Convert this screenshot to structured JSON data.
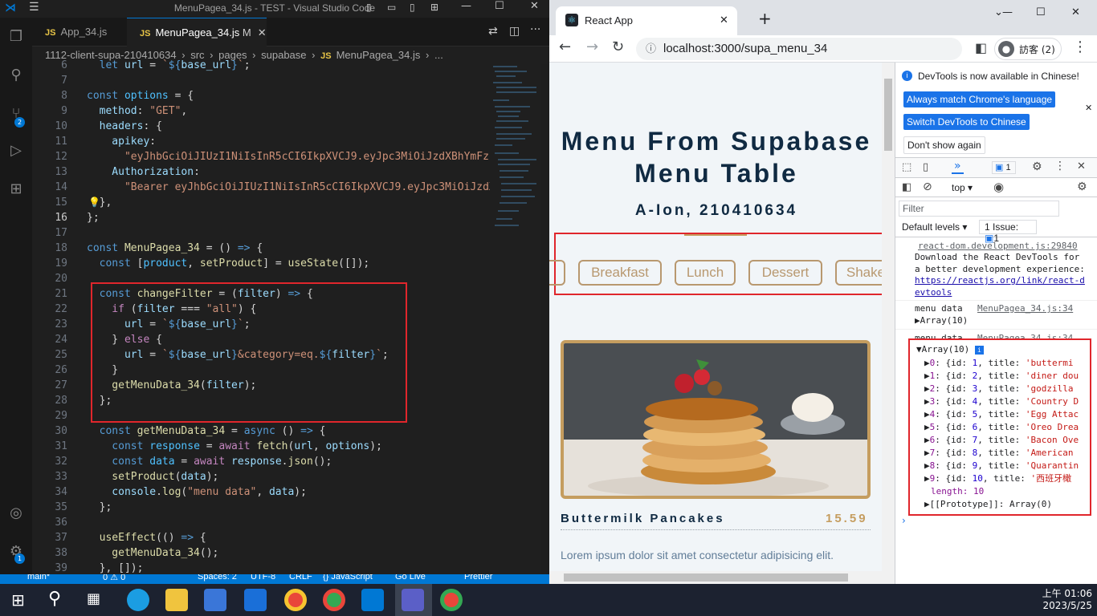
{
  "vscode": {
    "title": "MenuPagea_34.js - TEST - Visual Studio Code",
    "tabs": [
      {
        "label": "App_34.js",
        "modified": ""
      },
      {
        "label": "MenuPagea_34.js",
        "modified": "M"
      }
    ],
    "breadcrumb": [
      "1112-client-supa-210410634",
      "src",
      "pages",
      "supabase",
      "MenuPagea_34.js",
      "..."
    ],
    "activity_badges": {
      "source_control": "2",
      "accounts": "1"
    },
    "status_bar": [
      "main*",
      "0 ⚠ 0",
      "Spaces: 2",
      "UTF-8",
      "CRLF",
      "{} JavaScript",
      "Go Live",
      "Prettier"
    ],
    "lines": [
      {
        "n": "6",
        "tokens": [
          [
            "kw",
            "  let "
          ],
          [
            "var",
            "url"
          ],
          [
            "op",
            " = "
          ],
          [
            "str",
            "`"
          ],
          [
            "kw",
            "${"
          ],
          [
            "var",
            "base_url"
          ],
          [
            "kw",
            "}"
          ],
          [
            "str",
            "`"
          ],
          [
            "op",
            ";"
          ]
        ]
      },
      {
        "n": "7",
        "tokens": []
      },
      {
        "n": "8",
        "tokens": [
          [
            "kw",
            "const "
          ],
          [
            "cst",
            "options"
          ],
          [
            "op",
            " = {"
          ]
        ]
      },
      {
        "n": "9",
        "tokens": [
          [
            "var",
            "  method"
          ],
          [
            "op",
            ": "
          ],
          [
            "str",
            "\"GET\""
          ],
          [
            "op",
            ","
          ]
        ]
      },
      {
        "n": "10",
        "tokens": [
          [
            "var",
            "  headers"
          ],
          [
            "op",
            ": {"
          ]
        ]
      },
      {
        "n": "11",
        "tokens": [
          [
            "var",
            "    apikey"
          ],
          [
            "op",
            ":"
          ]
        ]
      },
      {
        "n": "12",
        "tokens": [
          [
            "str",
            "      \"eyJhbGciOiJIUzI1NiIsInR5cCI6IkpXVCJ9.eyJpc3MiOiJzdXBhYmFz"
          ]
        ]
      },
      {
        "n": "13",
        "tokens": [
          [
            "var",
            "    Authorization"
          ],
          [
            "op",
            ":"
          ]
        ]
      },
      {
        "n": "14",
        "tokens": [
          [
            "str",
            "      \"Bearer eyJhbGciOiJIUzI1NiIsInR5cCI6IkpXVCJ9.eyJpc3MiOiJzdX"
          ]
        ]
      },
      {
        "n": "15",
        "tokens": [
          [
            "op",
            "  },"
          ]
        ]
      },
      {
        "n": "16",
        "tokens": [
          [
            "op",
            "};"
          ]
        ]
      },
      {
        "n": "17",
        "tokens": []
      },
      {
        "n": "18",
        "tokens": [
          [
            "kw",
            "const "
          ],
          [
            "fn",
            "MenuPagea_34"
          ],
          [
            "op",
            " = () "
          ],
          [
            "kw",
            "=>"
          ],
          [
            "op",
            " {"
          ]
        ]
      },
      {
        "n": "19",
        "tokens": [
          [
            "kw",
            "  const "
          ],
          [
            "op",
            "["
          ],
          [
            "cst",
            "product"
          ],
          [
            "op",
            ", "
          ],
          [
            "fn",
            "setProduct"
          ],
          [
            "op",
            "] = "
          ],
          [
            "fn",
            "useState"
          ],
          [
            "op",
            "([]);"
          ]
        ]
      },
      {
        "n": "20",
        "tokens": []
      },
      {
        "n": "21",
        "tokens": [
          [
            "kw",
            "  const "
          ],
          [
            "fn",
            "changeFilter"
          ],
          [
            "op",
            " = ("
          ],
          [
            "var",
            "filter"
          ],
          [
            "op",
            ") "
          ],
          [
            "kw",
            "=>"
          ],
          [
            "op",
            " {"
          ]
        ]
      },
      {
        "n": "22",
        "tokens": [
          [
            "kw2",
            "    if "
          ],
          [
            "op",
            "("
          ],
          [
            "var",
            "filter"
          ],
          [
            "op",
            " === "
          ],
          [
            "str",
            "\"all\""
          ],
          [
            "op",
            ") {"
          ]
        ]
      },
      {
        "n": "23",
        "tokens": [
          [
            "var",
            "      url"
          ],
          [
            "op",
            " = "
          ],
          [
            "str",
            "`"
          ],
          [
            "kw",
            "${"
          ],
          [
            "var",
            "base_url"
          ],
          [
            "kw",
            "}"
          ],
          [
            "str",
            "`"
          ],
          [
            "op",
            ";"
          ]
        ]
      },
      {
        "n": "24",
        "tokens": [
          [
            "op",
            "    } "
          ],
          [
            "kw2",
            "else"
          ],
          [
            "op",
            " {"
          ]
        ]
      },
      {
        "n": "25",
        "tokens": [
          [
            "var",
            "      url"
          ],
          [
            "op",
            " = "
          ],
          [
            "str",
            "`"
          ],
          [
            "kw",
            "${"
          ],
          [
            "var",
            "base_url"
          ],
          [
            "kw",
            "}"
          ],
          [
            "str",
            "&category=eq."
          ],
          [
            "kw",
            "${"
          ],
          [
            "var",
            "filter"
          ],
          [
            "kw",
            "}"
          ],
          [
            "str",
            "`"
          ],
          [
            "op",
            ";"
          ]
        ]
      },
      {
        "n": "26",
        "tokens": [
          [
            "op",
            "    }"
          ]
        ]
      },
      {
        "n": "27",
        "tokens": [
          [
            "fn",
            "    getMenuData_34"
          ],
          [
            "op",
            "("
          ],
          [
            "var",
            "filter"
          ],
          [
            "op",
            ");"
          ]
        ]
      },
      {
        "n": "28",
        "tokens": [
          [
            "op",
            "  };"
          ]
        ]
      },
      {
        "n": "29",
        "tokens": []
      },
      {
        "n": "30",
        "tokens": [
          [
            "kw",
            "  const "
          ],
          [
            "fn",
            "getMenuData_34"
          ],
          [
            "op",
            " = "
          ],
          [
            "kw",
            "async"
          ],
          [
            "op",
            " () "
          ],
          [
            "kw",
            "=>"
          ],
          [
            "op",
            " {"
          ]
        ]
      },
      {
        "n": "31",
        "tokens": [
          [
            "kw",
            "    const "
          ],
          [
            "cst",
            "response"
          ],
          [
            "op",
            " = "
          ],
          [
            "kw2",
            "await "
          ],
          [
            "fn",
            "fetch"
          ],
          [
            "op",
            "("
          ],
          [
            "var",
            "url"
          ],
          [
            "op",
            ", "
          ],
          [
            "var",
            "options"
          ],
          [
            "op",
            ");"
          ]
        ]
      },
      {
        "n": "32",
        "tokens": [
          [
            "kw",
            "    const "
          ],
          [
            "cst",
            "data"
          ],
          [
            "op",
            " = "
          ],
          [
            "kw2",
            "await "
          ],
          [
            "var",
            "response"
          ],
          [
            "op",
            "."
          ],
          [
            "fn",
            "json"
          ],
          [
            "op",
            "();"
          ]
        ]
      },
      {
        "n": "33",
        "tokens": [
          [
            "fn",
            "    setProduct"
          ],
          [
            "op",
            "("
          ],
          [
            "var",
            "data"
          ],
          [
            "op",
            ");"
          ]
        ]
      },
      {
        "n": "34",
        "tokens": [
          [
            "var",
            "    console"
          ],
          [
            "op",
            "."
          ],
          [
            "fn",
            "log"
          ],
          [
            "op",
            "("
          ],
          [
            "str",
            "\"menu data\""
          ],
          [
            "op",
            ", "
          ],
          [
            "var",
            "data"
          ],
          [
            "op",
            ");"
          ]
        ]
      },
      {
        "n": "35",
        "tokens": [
          [
            "op",
            "  };"
          ]
        ]
      },
      {
        "n": "36",
        "tokens": []
      },
      {
        "n": "37",
        "tokens": [
          [
            "fn",
            "  useEffect"
          ],
          [
            "op",
            "(() "
          ],
          [
            "kw",
            "=>"
          ],
          [
            "op",
            " {"
          ]
        ]
      },
      {
        "n": "38",
        "tokens": [
          [
            "fn",
            "    getMenuData_34"
          ],
          [
            "op",
            "();"
          ]
        ]
      },
      {
        "n": "39",
        "tokens": [
          [
            "op",
            "  }, []);"
          ]
        ]
      }
    ]
  },
  "browser": {
    "tab_title": "React App",
    "url": "localhost:3000/supa_menu_34",
    "profile_label": "訪客 (2)",
    "page": {
      "title": "Menu From Supabase Menu Table",
      "subtitle": "A-Ion, 210410634",
      "filters": [
        "Breakfast",
        "Lunch",
        "Dessert",
        "Shake"
      ],
      "item": {
        "name": "Buttermilk Pancakes",
        "price": "15.59",
        "desc": "Lorem ipsum dolor sit amet consectetur adipisicing elit."
      }
    },
    "devtools": {
      "banner": "DevTools is now available in Chinese!",
      "btn_match": "Always match Chrome's language",
      "btn_switch": "Switch DevTools to Chinese",
      "btn_dont": "Don't show again",
      "issues_count": "1",
      "context": "top",
      "filter_placeholder": "Filter",
      "levels": "Default levels",
      "issue_label": "1 Issue:",
      "issue_count": "1",
      "msg1_source": "react-dom.development.js:29840",
      "msg1_text": "Download the React DevTools for a better development experience:",
      "msg1_link": "https://reactjs.org/link/react-devtools",
      "log_label": "menu data",
      "log_source": "MenuPagea_34.js:34",
      "array_label": "Array(10)",
      "rows": [
        {
          "i": "0",
          "id": "1",
          "title": "'buttermi"
        },
        {
          "i": "1",
          "id": "2",
          "title": "'diner dou"
        },
        {
          "i": "2",
          "id": "3",
          "title": "'godzilla"
        },
        {
          "i": "3",
          "id": "4",
          "title": "'Country D"
        },
        {
          "i": "4",
          "id": "5",
          "title": "'Egg Attac"
        },
        {
          "i": "5",
          "id": "6",
          "title": "'Oreo Drea"
        },
        {
          "i": "6",
          "id": "7",
          "title": "'Bacon Ove"
        },
        {
          "i": "7",
          "id": "8",
          "title": "'American"
        },
        {
          "i": "8",
          "id": "9",
          "title": "'Quarantin"
        },
        {
          "i": "9",
          "id": "10",
          "title": "'西班牙橄"
        }
      ],
      "length_label": "length: 10",
      "prototype_label": "[[Prototype]]: Array(0)"
    }
  },
  "taskbar": {
    "time": "上午 01:06",
    "date": "2023/5/25"
  },
  "colors": {
    "highlight_box": "#e0262c",
    "vscode_blue": "#0078d4",
    "accent_gold": "#b8986f"
  }
}
